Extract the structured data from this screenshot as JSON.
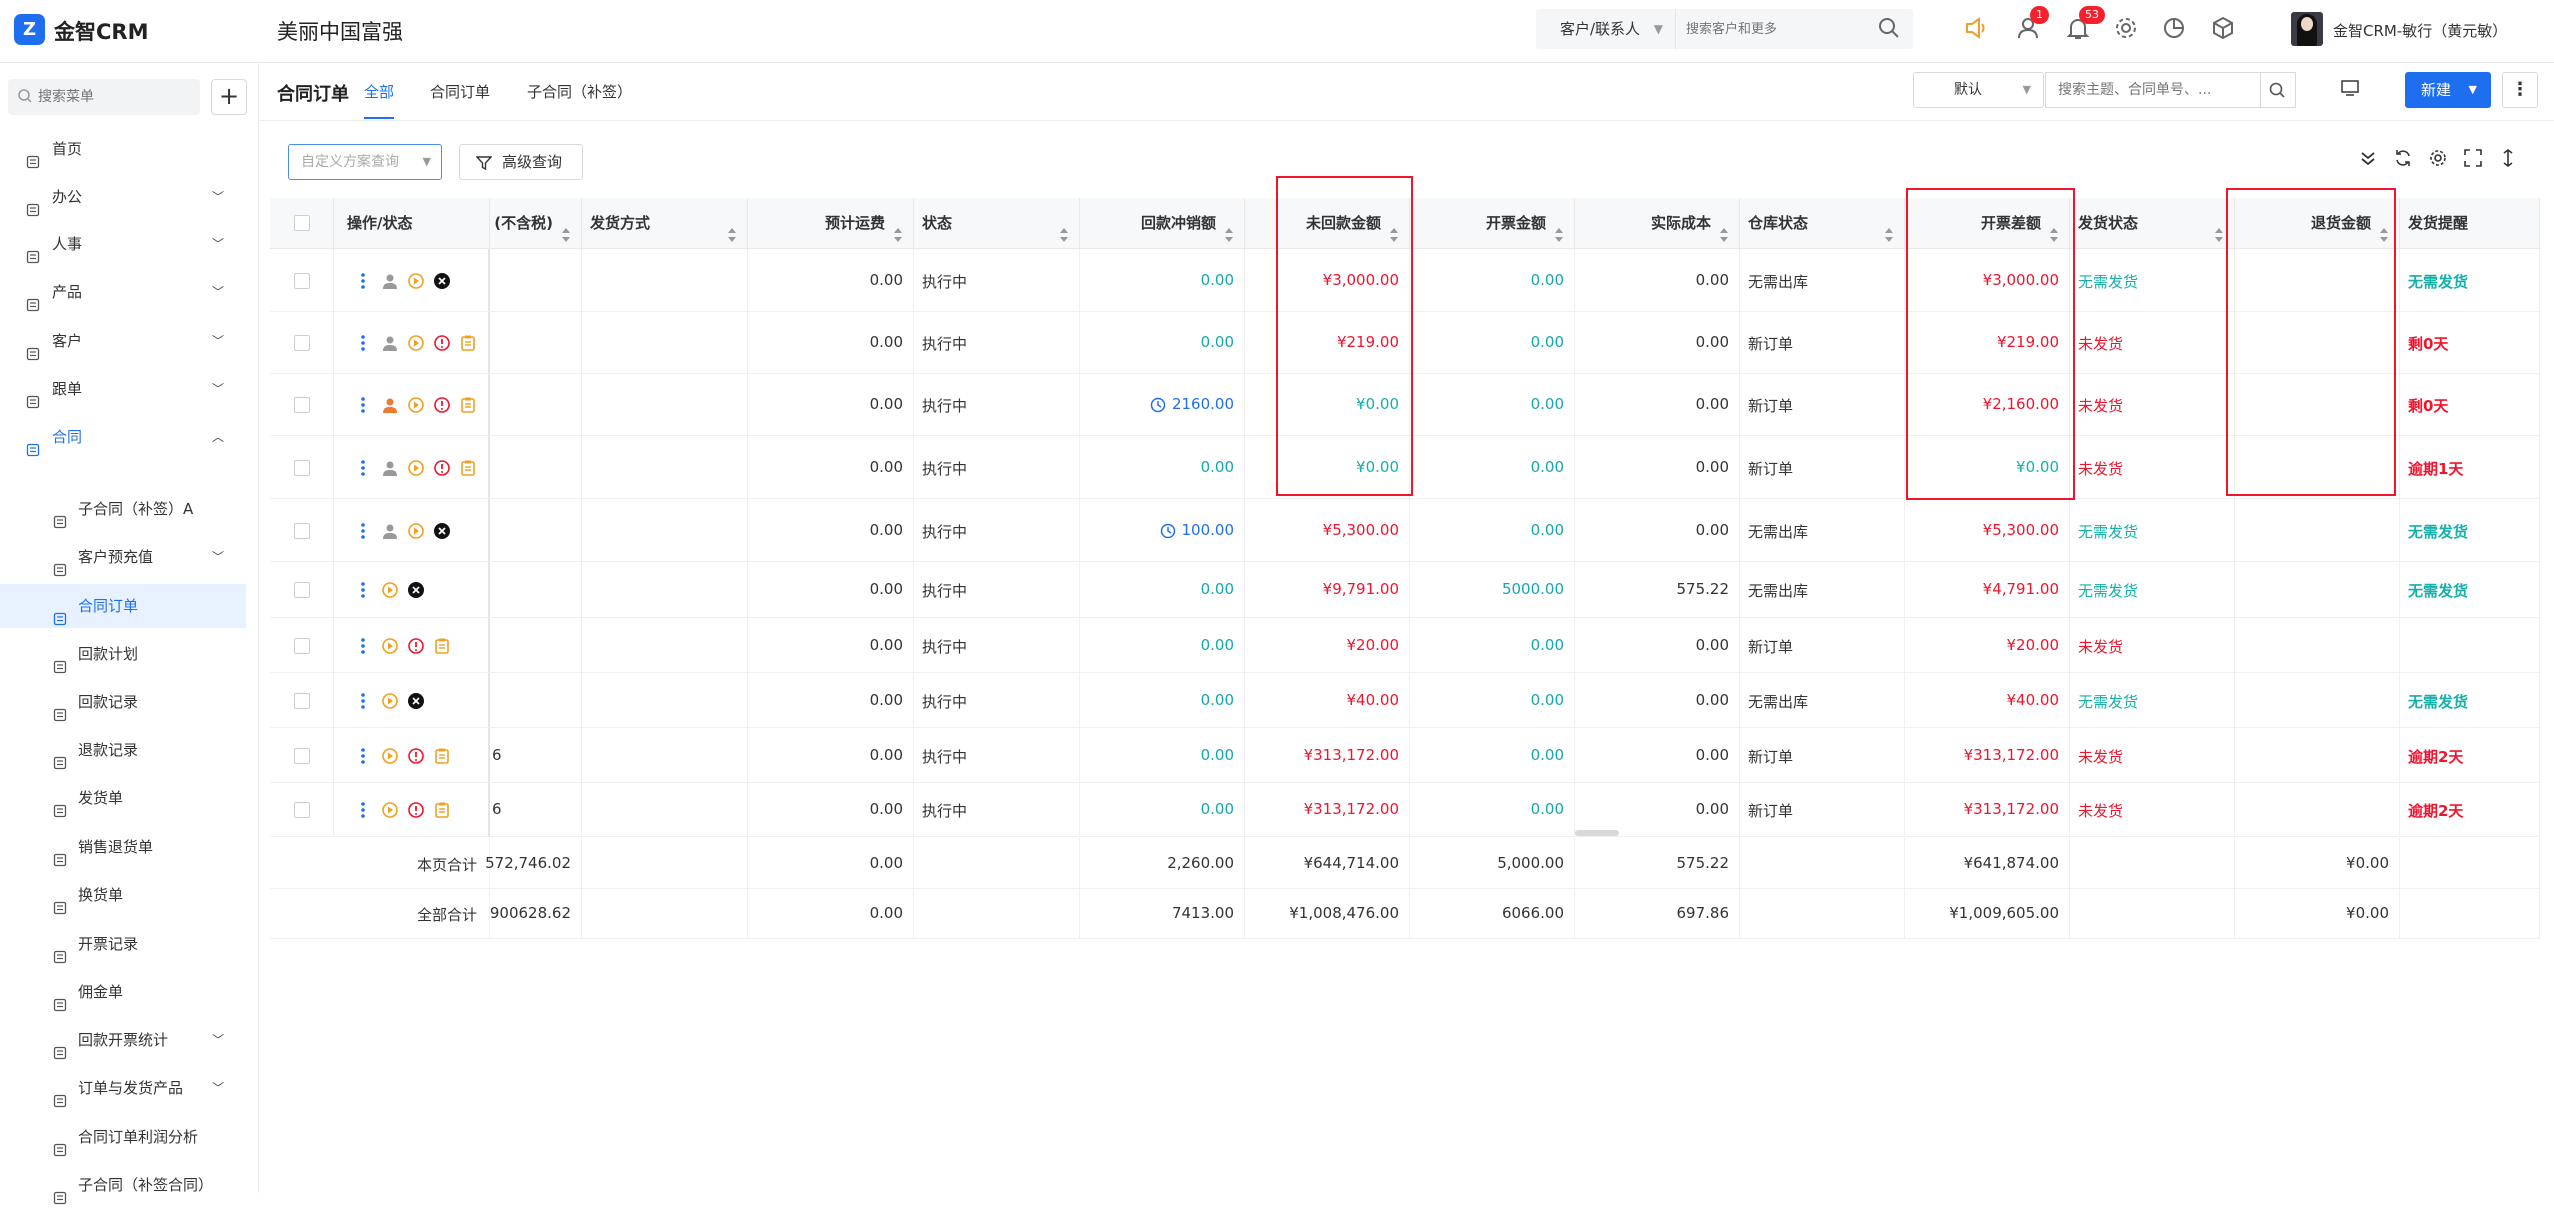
{
  "app": {
    "name": "金智CRM",
    "logo_icon": "z-logo-icon",
    "company": "美丽中国富强"
  },
  "top_search": {
    "scope": "客户/联系人",
    "placeholder": "搜索客户和更多"
  },
  "top_badges": {
    "todo": "1",
    "notify": "53"
  },
  "user": {
    "name": "金智CRM-敏行（黄元敏）"
  },
  "sidebar": {
    "search_placeholder": "搜索菜单",
    "items": [
      {
        "label": "首页",
        "icon": "home-icon"
      },
      {
        "label": "办公",
        "icon": "office-icon",
        "chevron": "down"
      },
      {
        "label": "人事",
        "icon": "people-icon",
        "chevron": "down"
      },
      {
        "label": "产品",
        "icon": "box-icon",
        "chevron": "down"
      },
      {
        "label": "客户",
        "icon": "customer-icon",
        "chevron": "down"
      },
      {
        "label": "跟单",
        "icon": "follow-icon",
        "chevron": "down"
      },
      {
        "label": "合同",
        "icon": "contract-icon",
        "chevron": "up"
      },
      {
        "label": "子合同（补签）A",
        "icon": "doc-icon"
      },
      {
        "label": "客户预充值",
        "icon": "wallet-icon",
        "chevron": "down"
      },
      {
        "label": "合同订单",
        "icon": "order-icon"
      },
      {
        "label": "回款计划",
        "icon": "plan-icon"
      },
      {
        "label": "回款记录",
        "icon": "record-icon"
      },
      {
        "label": "退款记录",
        "icon": "refund-icon"
      },
      {
        "label": "发货单",
        "icon": "ship-icon"
      },
      {
        "label": "销售退货单",
        "icon": "return-icon"
      },
      {
        "label": "换货单",
        "icon": "exchange-icon"
      },
      {
        "label": "开票记录",
        "icon": "invoice-icon"
      },
      {
        "label": "佣金单",
        "icon": "commission-icon"
      },
      {
        "label": "回款开票统计",
        "icon": "stats-icon",
        "chevron": "down"
      },
      {
        "label": "订单与发货产品",
        "icon": "product-ship-icon",
        "chevron": "down"
      },
      {
        "label": "合同订单利润分析",
        "icon": "analysis-icon"
      },
      {
        "label": "子合同（补签合同）",
        "icon": "doc-icon"
      }
    ]
  },
  "page": {
    "title": "合同订单",
    "tabs": [
      "全部",
      "合同订单",
      "子合同（补签）"
    ],
    "view": "默认",
    "search_placeholder": "搜索主题、合同单号、...",
    "new_label": "新建",
    "scheme_placeholder": "自定义方案查询",
    "adv_search": "高级查询"
  },
  "table": {
    "columns": [
      "操作/状态",
      "(不含税)",
      "发货方式",
      "预计运费",
      "状态",
      "回款冲销额",
      "未回款金额",
      "开票金额",
      "实际成本",
      "仓库状态",
      "开票差额",
      "发货状态",
      "退货金额",
      "发货提醒"
    ],
    "rows": [
      {
        "ops": [
          "more",
          "user",
          "play",
          "close"
        ],
        "tax": "",
        "freight": "0.00",
        "status": "执行中",
        "writeoff": "0.00",
        "writeoff_clock": false,
        "unpaid": "¥3,000.00",
        "unpaid_color": "red",
        "invoiced": "0.00",
        "cost": "0.00",
        "warehouse": "无需出库",
        "diff": "¥3,000.00",
        "diff_color": "red",
        "ship": "无需发货",
        "ship_color": "teal",
        "refund": "",
        "remind": "无需发货",
        "remind_color": "teal"
      },
      {
        "ops": [
          "more",
          "user",
          "play",
          "warn",
          "note"
        ],
        "tax": "",
        "freight": "0.00",
        "status": "执行中",
        "writeoff": "0.00",
        "writeoff_clock": false,
        "unpaid": "¥219.00",
        "unpaid_color": "red",
        "invoiced": "0.00",
        "cost": "0.00",
        "warehouse": "新订单",
        "diff": "¥219.00",
        "diff_color": "red",
        "ship": "未发货",
        "ship_color": "red",
        "refund": "",
        "remind": "剩0天",
        "remind_color": "red"
      },
      {
        "ops": [
          "more",
          "user-orange",
          "play",
          "warn",
          "note"
        ],
        "tax": "",
        "freight": "0.00",
        "status": "执行中",
        "writeoff": "2160.00",
        "writeoff_clock": true,
        "unpaid": "¥0.00",
        "unpaid_color": "teal",
        "invoiced": "0.00",
        "cost": "0.00",
        "warehouse": "新订单",
        "diff": "¥2,160.00",
        "diff_color": "red",
        "ship": "未发货",
        "ship_color": "red",
        "refund": "",
        "remind": "剩0天",
        "remind_color": "red"
      },
      {
        "ops": [
          "more",
          "user",
          "play",
          "warn",
          "note"
        ],
        "tax": "",
        "freight": "0.00",
        "status": "执行中",
        "writeoff": "0.00",
        "writeoff_clock": false,
        "unpaid": "¥0.00",
        "unpaid_color": "teal",
        "invoiced": "0.00",
        "cost": "0.00",
        "warehouse": "新订单",
        "diff": "¥0.00",
        "diff_color": "teal",
        "ship": "未发货",
        "ship_color": "red",
        "refund": "",
        "remind": "逾期1天",
        "remind_color": "red"
      },
      {
        "ops": [
          "more",
          "user",
          "play",
          "close"
        ],
        "tax": "",
        "freight": "0.00",
        "status": "执行中",
        "writeoff": "100.00",
        "writeoff_clock": true,
        "unpaid": "¥5,300.00",
        "unpaid_color": "red",
        "invoiced": "0.00",
        "cost": "0.00",
        "warehouse": "无需出库",
        "diff": "¥5,300.00",
        "diff_color": "red",
        "ship": "无需发货",
        "ship_color": "teal",
        "refund": "",
        "remind": "无需发货",
        "remind_color": "teal"
      },
      {
        "ops": [
          "more",
          "play",
          "close"
        ],
        "tax": "",
        "freight": "0.00",
        "status": "执行中",
        "writeoff": "0.00",
        "writeoff_clock": false,
        "unpaid": "¥9,791.00",
        "unpaid_color": "red",
        "invoiced": "5000.00",
        "cost": "575.22",
        "warehouse": "无需出库",
        "diff": "¥4,791.00",
        "diff_color": "red",
        "ship": "无需发货",
        "ship_color": "teal",
        "refund": "",
        "remind": "无需发货",
        "remind_color": "teal"
      },
      {
        "ops": [
          "more",
          "play",
          "warn",
          "note"
        ],
        "tax": "",
        "freight": "0.00",
        "status": "执行中",
        "writeoff": "0.00",
        "writeoff_clock": false,
        "unpaid": "¥20.00",
        "unpaid_color": "red",
        "invoiced": "0.00",
        "cost": "0.00",
        "warehouse": "新订单",
        "diff": "¥20.00",
        "diff_color": "red",
        "ship": "未发货",
        "ship_color": "red",
        "refund": "",
        "remind": "",
        "remind_color": "red"
      },
      {
        "ops": [
          "more",
          "play",
          "close"
        ],
        "tax": "",
        "freight": "0.00",
        "status": "执行中",
        "writeoff": "0.00",
        "writeoff_clock": false,
        "unpaid": "¥40.00",
        "unpaid_color": "red",
        "invoiced": "0.00",
        "cost": "0.00",
        "warehouse": "无需出库",
        "diff": "¥40.00",
        "diff_color": "red",
        "ship": "无需发货",
        "ship_color": "teal",
        "refund": "",
        "remind": "无需发货",
        "remind_color": "teal"
      },
      {
        "ops": [
          "more",
          "play",
          "warn",
          "note"
        ],
        "tax": "6",
        "freight": "0.00",
        "status": "执行中",
        "writeoff": "0.00",
        "writeoff_clock": false,
        "unpaid": "¥313,172.00",
        "unpaid_color": "red",
        "invoiced": "0.00",
        "cost": "0.00",
        "warehouse": "新订单",
        "diff": "¥313,172.00",
        "diff_color": "red",
        "ship": "未发货",
        "ship_color": "red",
        "refund": "",
        "remind": "逾期2天",
        "remind_color": "red"
      },
      {
        "ops": [
          "more",
          "play",
          "warn",
          "note"
        ],
        "tax": "6",
        "freight": "0.00",
        "status": "执行中",
        "writeoff": "0.00",
        "writeoff_clock": false,
        "unpaid": "¥313,172.00",
        "unpaid_color": "red",
        "invoiced": "0.00",
        "cost": "0.00",
        "warehouse": "新订单",
        "diff": "¥313,172.00",
        "diff_color": "red",
        "ship": "未发货",
        "ship_color": "red",
        "refund": "",
        "remind": "逾期2天",
        "remind_color": "red"
      }
    ],
    "totals": [
      {
        "label": "本页合计",
        "tax": "572,746.02",
        "freight": "0.00",
        "writeoff": "2,260.00",
        "unpaid": "¥644,714.00",
        "invoiced": "5,000.00",
        "cost": "575.22",
        "diff": "¥641,874.00",
        "refund": "¥0.00"
      },
      {
        "label": "全部合计",
        "tax": "900628.62",
        "freight": "0.00",
        "writeoff": "7413.00",
        "unpaid": "¥1,008,476.00",
        "invoiced": "6066.00",
        "cost": "697.86",
        "diff": "¥1,009,605.00",
        "refund": "¥0.00"
      }
    ]
  },
  "colors": {
    "accent": "#1e6ff0",
    "red": "#f0142d",
    "teal": "#15b0aa",
    "highlight_box": "#f0142d"
  }
}
